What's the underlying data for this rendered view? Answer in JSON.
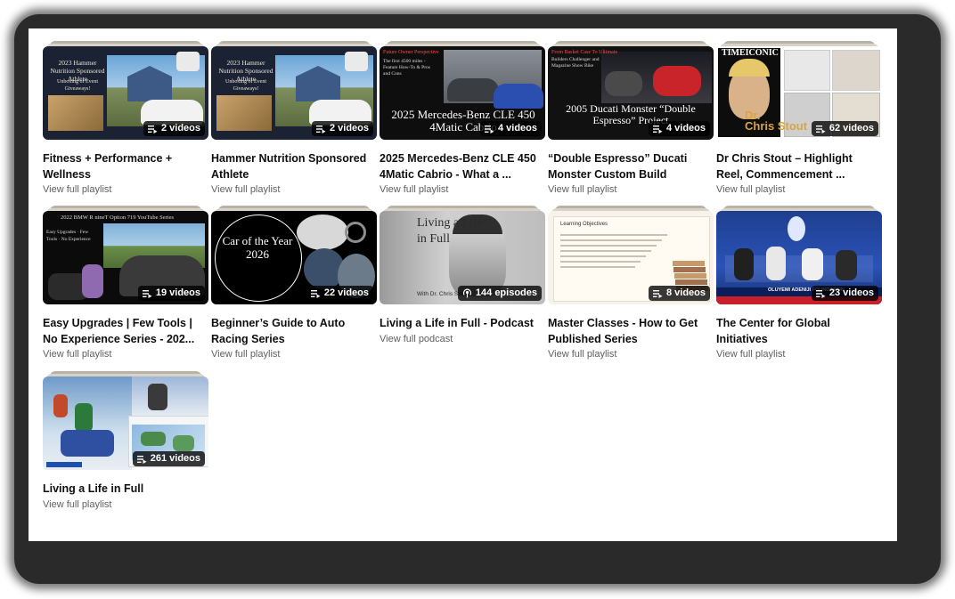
{
  "playlists": [
    {
      "title": "Fitness + Performance + Wellness",
      "count": "2 videos",
      "link": "View full playlist",
      "thumb_text": "2023 Hammer Nutrition Sponsored Athlete",
      "thumb_sub": "Unboxing of Event Giveaways!",
      "icon": "playlist-icon",
      "bg": "#1a2233",
      "accent": "#e8e2d5"
    },
    {
      "title": "Hammer Nutrition Sponsored Athlete",
      "count": "2 videos",
      "link": "View full playlist",
      "thumb_text": "2023 Hammer Nutrition Sponsored Athlete",
      "thumb_sub": "Unboxing of Event Giveaways!",
      "icon": "playlist-icon",
      "bg": "#1a2233",
      "accent": "#e8e2d5"
    },
    {
      "title": "2025 Mercedes-Benz CLE 450 4Matic Cabrio - What a ...",
      "count": "4 videos",
      "link": "View full playlist",
      "thumb_text": "2025 Mercedes-Benz CLE 450 4Matic Cabrio",
      "thumb_sub": "The first 4500 miles - Feature How-To & Pros and Cons",
      "icon": "playlist-icon",
      "bg": "#0e0e0e",
      "accent": "#2a4fb0"
    },
    {
      "title": "“Double Espresso” Ducati Monster Custom Build",
      "count": "4 videos",
      "link": "View full playlist",
      "thumb_text": "2005 Ducati Monster “Double Espresso” Project",
      "thumb_sub": "Builders Challenger and Magazine Show Bike",
      "icon": "playlist-icon",
      "bg": "#111111",
      "accent": "#c8242a"
    },
    {
      "title": "Dr Chris Stout – Highlight Reel, Commencement ...",
      "count": "62 videos",
      "link": "View full playlist",
      "thumb_text": "Dr. Chris Stout",
      "thumb_sub": "TIMEICONIC",
      "icon": "playlist-icon",
      "bg": "#ffffff",
      "accent": "#d9a441"
    },
    {
      "title": "Easy Upgrades | Few Tools | No Experience Series - 202...",
      "count": "19 videos",
      "link": "View full playlist",
      "thumb_text": "2022 BMW R nineT Option 719 YouTube Series",
      "thumb_sub": "Easy Upgrades · Few Tools · No Experience",
      "icon": "playlist-icon",
      "bg": "#0b0b0b",
      "accent": "#c9c9c9"
    },
    {
      "title": "Beginner’s Guide to Auto Racing Series",
      "count": "22 videos",
      "link": "View full playlist",
      "thumb_text": "Car of the Year 2026",
      "thumb_sub": "",
      "icon": "playlist-icon",
      "bg": "#000000",
      "accent": "#8f8f8f"
    },
    {
      "title": "Living a Life in Full - Podcast",
      "count": "144 episodes",
      "link": "View full podcast",
      "thumb_text": "Living a Life in Full",
      "thumb_sub": "With Dr. Chris Stout",
      "icon": "podcast-icon",
      "bg": "#bdbdbd",
      "accent": "#444444"
    },
    {
      "title": "Master Classes - How to Get Published Series",
      "count": "8 videos",
      "link": "View full playlist",
      "thumb_text": "Learning Objectives",
      "thumb_sub": "",
      "icon": "playlist-icon",
      "bg": "#f7f2ea",
      "accent": "#8a5a3a"
    },
    {
      "title": "The Center for Global Initiatives",
      "count": "23 videos",
      "link": "View full playlist",
      "thumb_text": "OLUYEMI ADENIJI FOUNDATION",
      "thumb_sub": "",
      "icon": "playlist-icon",
      "bg": "#2a52b8",
      "accent": "#7fb3ff"
    },
    {
      "title": "Living a Life in Full",
      "count": "261 videos",
      "link": "View full playlist",
      "thumb_text": "",
      "thumb_sub": "",
      "icon": "playlist-icon",
      "bg": "#6a8fb8",
      "accent": "#3a6ba0"
    }
  ]
}
